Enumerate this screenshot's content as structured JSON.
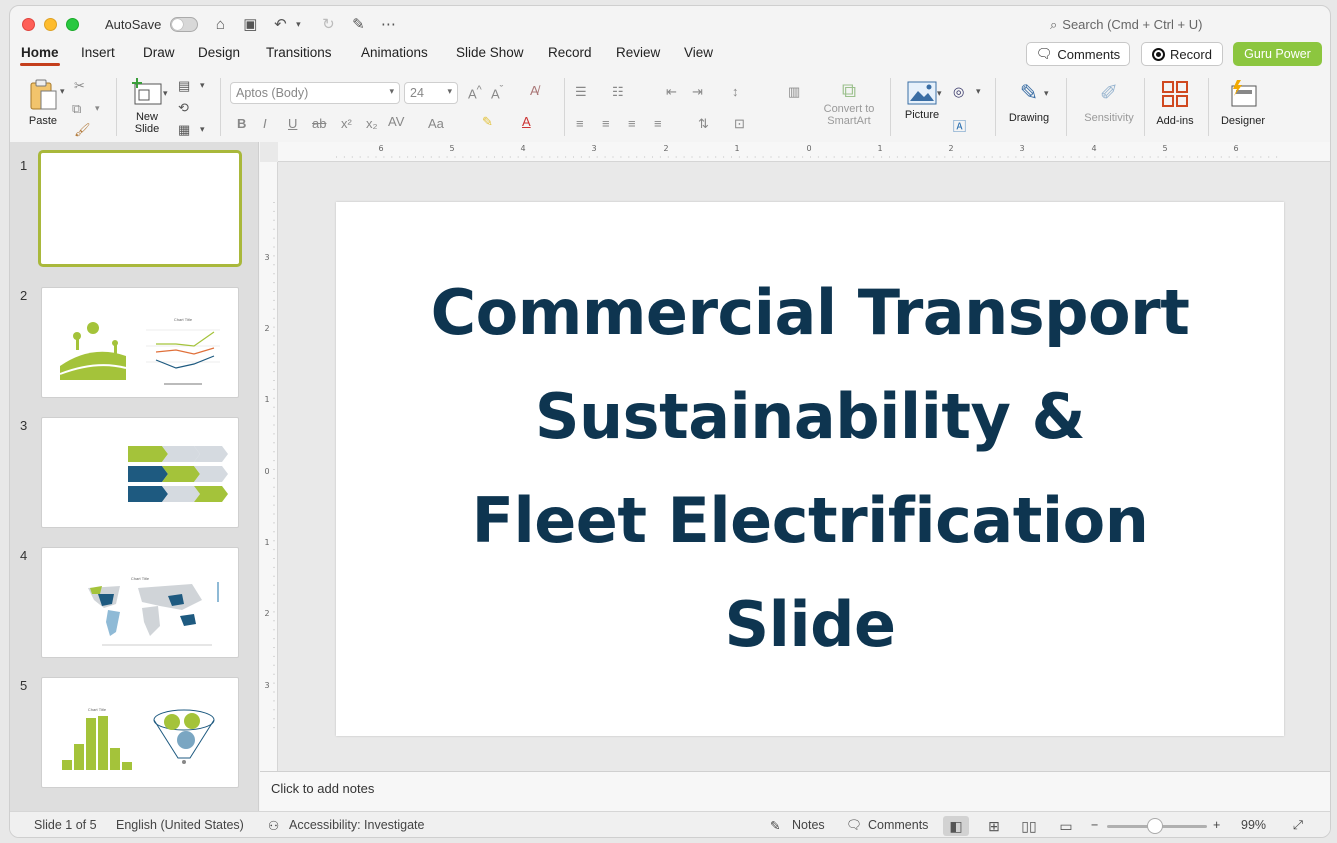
{
  "titlebar": {
    "autosave_label": "AutoSave",
    "search_placeholder": "Search (Cmd + Ctrl + U)"
  },
  "tabs": [
    "Home",
    "Insert",
    "Draw",
    "Design",
    "Transitions",
    "Animations",
    "Slide Show",
    "Record",
    "Review",
    "View"
  ],
  "header_buttons": {
    "comments": "Comments",
    "record": "Record",
    "guru": "Guru Power"
  },
  "ribbon": {
    "paste": "Paste",
    "new_slide_line1": "New",
    "new_slide_line2": "Slide",
    "font_name": "Aptos (Body)",
    "font_size": "24",
    "convert_line1": "Convert to",
    "convert_line2": "SmartArt",
    "picture": "Picture",
    "drawing": "Drawing",
    "sensitivity": "Sensitivity",
    "addins": "Add-ins",
    "designer": "Designer"
  },
  "thumbnails": [
    {
      "number": "1",
      "chart_title": ""
    },
    {
      "number": "2",
      "chart_title": "Chart Title"
    },
    {
      "number": "3",
      "chart_title": ""
    },
    {
      "number": "4",
      "chart_title": "Chart Title"
    },
    {
      "number": "5",
      "chart_title": "Chart Title"
    }
  ],
  "ruler": {
    "h_ticks": [
      "6",
      "5",
      "4",
      "3",
      "2",
      "1",
      "0",
      "1",
      "2",
      "3",
      "4",
      "5",
      "6"
    ],
    "v_ticks": [
      "3",
      "2",
      "1",
      "0",
      "1",
      "2",
      "3"
    ]
  },
  "slide": {
    "title_lines": [
      "Commercial Transport",
      "Sustainability &",
      "Fleet Electrification",
      "Slide"
    ]
  },
  "notes_placeholder": "Click to add notes",
  "status": {
    "slide_position": "Slide 1 of 5",
    "language": "English (United States)",
    "accessibility": "Accessibility: Investigate",
    "notes": "Notes",
    "comments": "Comments",
    "zoom": "99%"
  },
  "colors": {
    "accent_tab": "#c43e1c",
    "guru_green": "#8cc63f",
    "title_navy": "#0e3550",
    "thumb_green": "#a4c33a",
    "thumb_navy": "#1e5a80"
  }
}
